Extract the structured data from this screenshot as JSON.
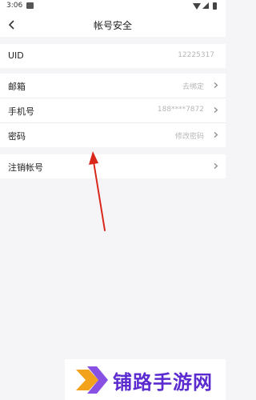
{
  "status_bar": {
    "time": "3:06"
  },
  "header": {
    "title": "帐号安全"
  },
  "rows": [
    {
      "label": "UID",
      "value": "12225317"
    },
    {
      "label": "邮箱",
      "value": "去绑定"
    },
    {
      "label": "手机号",
      "value": "188****7872"
    },
    {
      "label": "密码",
      "value": "修改密码"
    },
    {
      "label": "注销帐号",
      "value": ""
    }
  ],
  "watermark": {
    "text": "铺路手游网"
  },
  "colors": {
    "accent_arrow": "#d9271b",
    "watermark_text": "#5b2bd0"
  },
  "icons": [
    "back-arrow-icon",
    "chevron-right-icon",
    "wifi-icon",
    "signal-icon",
    "battery-icon"
  ]
}
